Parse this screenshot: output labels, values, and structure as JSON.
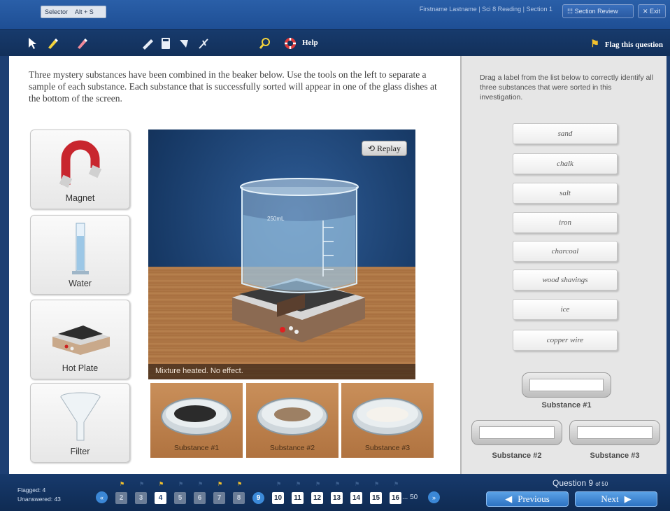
{
  "topbar": {
    "selector_label": "Selector",
    "selector_shortcut": "Alt + S",
    "session_info": "Firstname Lastname | Sci 8 Reading | Section 1",
    "section_review": "Section Review",
    "exit": "Exit"
  },
  "toolbar": {
    "help": "Help",
    "flag": "Flag this question",
    "tools": [
      "pointer-icon",
      "highlighter-icon",
      "eraser-icon",
      "ruler-icon",
      "calculator-icon",
      "line-reader-icon",
      "answer-eliminator-icon",
      "magnifier-icon",
      "help-icon"
    ]
  },
  "question": {
    "instructions": "Three mystery substances have been combined in the beaker below. Use the tools on the left to separate a sample of each substance. Each substance that is successfully sorted will appear in one of the glass dishes at the bottom of the screen.",
    "tools": [
      {
        "label": "Magnet",
        "icon": "magnet-icon"
      },
      {
        "label": "Water",
        "icon": "graduated-cylinder-icon"
      },
      {
        "label": "Hot Plate",
        "icon": "hot-plate-icon"
      },
      {
        "label": "Filter",
        "icon": "funnel-icon"
      }
    ],
    "replay": "Replay",
    "status": "Mixture heated. No effect.",
    "beaker_mark": "250mL",
    "dishes": [
      "Substance #1",
      "Substance #2",
      "Substance #3"
    ]
  },
  "answer_panel": {
    "instructions": "Drag a label from the list below to correctly identify all three substances that were sorted in this investigation.",
    "options": [
      "sand",
      "chalk",
      "salt",
      "iron",
      "charcoal",
      "wood shavings",
      "ice",
      "copper wire"
    ],
    "targets": [
      "Substance #1",
      "Substance #2",
      "Substance #3"
    ]
  },
  "bottombar": {
    "flagged": "Flagged: 4",
    "unanswered": "Unanswered: 43",
    "pages": [
      "2",
      "3",
      "4",
      "5",
      "6",
      "7",
      "8",
      "9",
      "10",
      "11",
      "12",
      "13",
      "14",
      "15",
      "16"
    ],
    "ellipsis": "...",
    "last_page": "50",
    "question_label": "Question 9",
    "question_of": "of 50",
    "previous": "Previous",
    "next": "Next"
  },
  "colors": {
    "header_blue": "#1e4e94",
    "toolbar_navy": "#12305a",
    "panel_gray": "#e6e6e6",
    "flag_yellow": "#f2c12e",
    "button_blue": "#3c8ad9"
  }
}
